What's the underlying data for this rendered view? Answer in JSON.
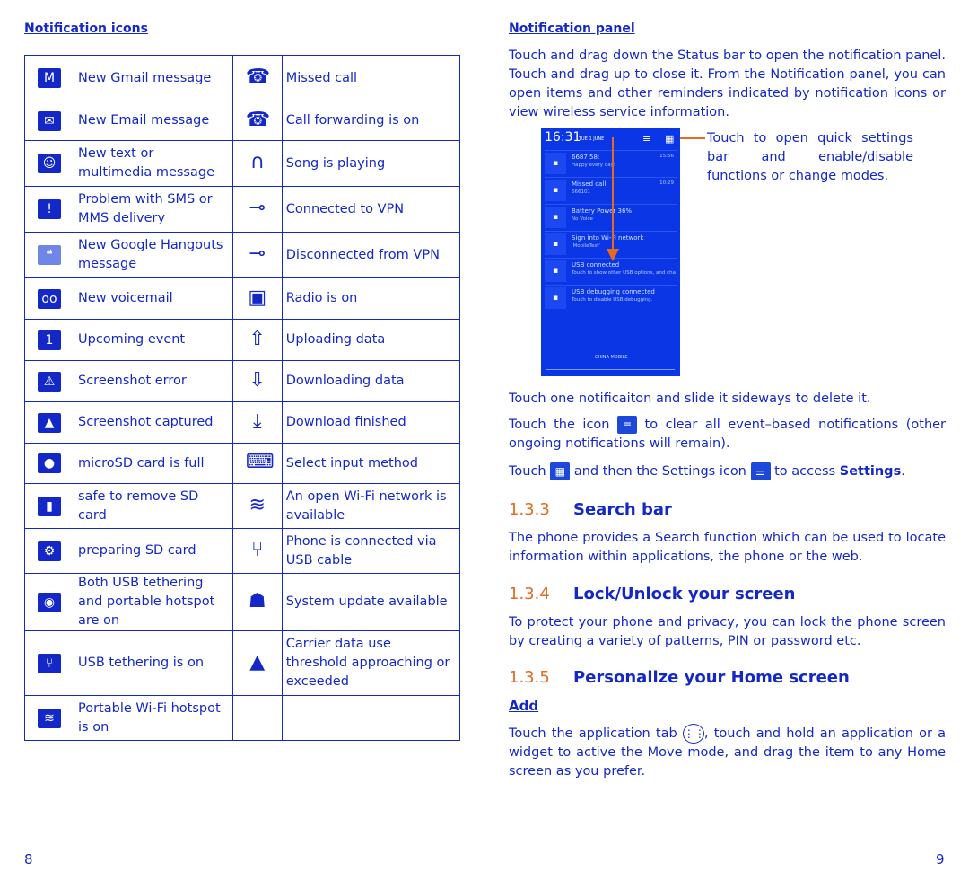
{
  "left": {
    "heading": "Notification icons",
    "page_number": "8",
    "rows": [
      [
        "gmail-icon",
        "New Gmail message",
        "missed-call-icon",
        "Missed call"
      ],
      [
        "email-icon",
        "New Email message",
        "call-forwarding-icon",
        "Call forwarding is on"
      ],
      [
        "sms-icon",
        "New text or multimedia message",
        "headphones-icon",
        "Song is playing"
      ],
      [
        "sms-error-icon",
        "Problem with SMS or MMS delivery",
        "vpn-key-light-icon",
        "Connected to VPN"
      ],
      [
        "hangouts-icon",
        "New Google Hangouts message",
        "vpn-key-dark-icon",
        "Disconnected from VPN"
      ],
      [
        "voicemail-icon",
        "New voicemail",
        "radio-icon",
        "Radio is on"
      ],
      [
        "calendar-icon",
        "Upcoming event",
        "upload-icon",
        "Uploading data"
      ],
      [
        "screenshot-error-icon",
        "Screenshot error",
        "download-icon",
        "Downloading data"
      ],
      [
        "screenshot-icon",
        " Screenshot captured",
        "download-finished-icon",
        "Download finished"
      ],
      [
        "sd-full-icon",
        "microSD card is full",
        "keyboard-icon",
        "Select input method"
      ],
      [
        "sd-safe-icon",
        "safe to remove SD card",
        "open-wifi-icon",
        "An open Wi-Fi network is available"
      ],
      [
        "sd-preparing-icon",
        "preparing SD card",
        "usb-icon",
        "Phone is connected via USB cable"
      ],
      [
        "tether-hotspot-icon",
        "Both USB tethering and portable hotspot are on",
        "android-update-icon",
        "System update available"
      ],
      [
        "usb-tether-icon",
        "USB tethering is on",
        "warning-icon",
        "Carrier data use threshold approaching or exceeded"
      ],
      [
        "wifi-hotspot-icon",
        "Portable Wi-Fi hotspot is on",
        "",
        ""
      ]
    ]
  },
  "right": {
    "page_number": "9",
    "panel_heading": "Notification panel",
    "panel_text": "Touch and drag down the Status bar to open the notification panel. Touch and drag up to close it. From the Notification panel, you can open items and other reminders indicated by notification icons or view wireless service information.",
    "callout": "Touch to open quick settings bar and enable/disable functions or change modes.",
    "phone": {
      "time": "16:31",
      "date": "TUE 1 JUNE",
      "footer": "CHINA MOBILE",
      "items": [
        {
          "title": "6687 58:",
          "sub": "Happy every day!",
          "time": "15:56"
        },
        {
          "title": "Missed call",
          "sub": "666101",
          "time": "10:29"
        },
        {
          "title": "Battery Power 36%",
          "sub": "No Voice",
          "time": ""
        },
        {
          "title": "Sign into Wi-Fi network",
          "sub": "'MobileTest'",
          "time": ""
        },
        {
          "title": "USB connected",
          "sub": "Touch to show other USB options, and cha",
          "time": ""
        },
        {
          "title": "USB debugging connected",
          "sub": "Touch to disable USB debugging.",
          "time": ""
        }
      ]
    },
    "delete_text": "Touch one notificaiton and slide it sideways to delete it.",
    "clear_a": "Touch the icon",
    "clear_b": "to clear all event–based notifications (other ongoing notifications will remain).",
    "settings_a": "Touch",
    "settings_b": "and then the Settings icon",
    "settings_c": "to access",
    "settings_bold": "Settings",
    "s133_num": "1.3.3",
    "s133_title": "Search bar",
    "s133_text": "The phone provides a Search function which can be used to locate information within applications, the phone or the web.",
    "s134_num": "1.3.4",
    "s134_title": "Lock/Unlock your screen",
    "s134_text": "To protect your phone and privacy, you can lock the phone screen by creating a variety of patterns, PIN or password etc.",
    "s135_num": "1.3.5",
    "s135_title": "Personalize your Home screen",
    "add_heading": "Add",
    "add_a": "Touch the application tab",
    "add_b": ", touch and hold an application or a widget to active the Move mode, and drag the item to any Home screen as you prefer."
  },
  "colors": {
    "text": "#1428c8",
    "accent": "#e06a1e",
    "screen": "#0a36e6"
  }
}
